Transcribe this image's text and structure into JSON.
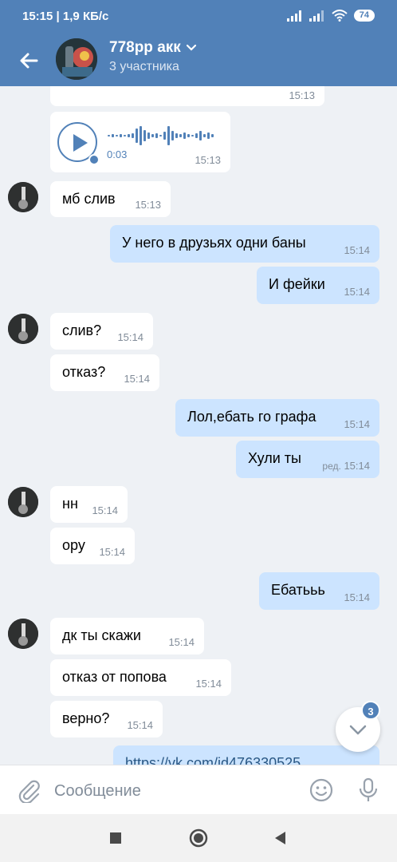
{
  "status": {
    "time": "15:15",
    "speed": "1,9 КБ/с",
    "battery": "74"
  },
  "header": {
    "title": "778pp акк",
    "subtitle": "3 участника"
  },
  "voice": {
    "duration": "0:03",
    "time": "15:13"
  },
  "prev_time": "15:13",
  "messages": [
    {
      "dir": "in",
      "text": "мб слив",
      "time": "15:13"
    },
    {
      "dir": "out",
      "text": "У него в друзьях одни баны",
      "time": "15:14"
    },
    {
      "dir": "out",
      "text": "И фейки",
      "time": "15:14"
    },
    {
      "dir": "in",
      "text": "слив?",
      "time": "15:14"
    },
    {
      "dir": "in",
      "text": "отказ?",
      "time": "15:14"
    },
    {
      "dir": "out",
      "text": "Лол,ебать го графа",
      "time": "15:14"
    },
    {
      "dir": "out",
      "text": "Хули ты",
      "time": "15:14",
      "edited": "ред."
    },
    {
      "dir": "in",
      "text": "нн",
      "time": "15:14"
    },
    {
      "dir": "in",
      "text": "ору",
      "time": "15:14"
    },
    {
      "dir": "out",
      "text": "Ебатььь",
      "time": "15:14"
    },
    {
      "dir": "in",
      "text": "дк ты скажи",
      "time": "15:14"
    },
    {
      "dir": "in",
      "text": "отказ от попова",
      "time": "15:14"
    },
    {
      "dir": "in",
      "text": "верно?",
      "time": "15:14"
    },
    {
      "dir": "out",
      "text": "https://vk.com/id476330525"
    }
  ],
  "unread_count": "3",
  "composer": {
    "placeholder": "Сообщение"
  },
  "colors": {
    "header": "#5181b8",
    "incoming": "#ffffff",
    "outgoing": "#cce4ff",
    "background": "#eef1f5"
  },
  "icons": [
    "back-arrow-icon",
    "chevron-down-icon",
    "play-icon",
    "attach-icon",
    "emoji-icon",
    "mic-icon",
    "scroll-down-icon",
    "recents-icon",
    "home-icon",
    "back-nav-icon",
    "signal-icon",
    "wifi-icon"
  ]
}
